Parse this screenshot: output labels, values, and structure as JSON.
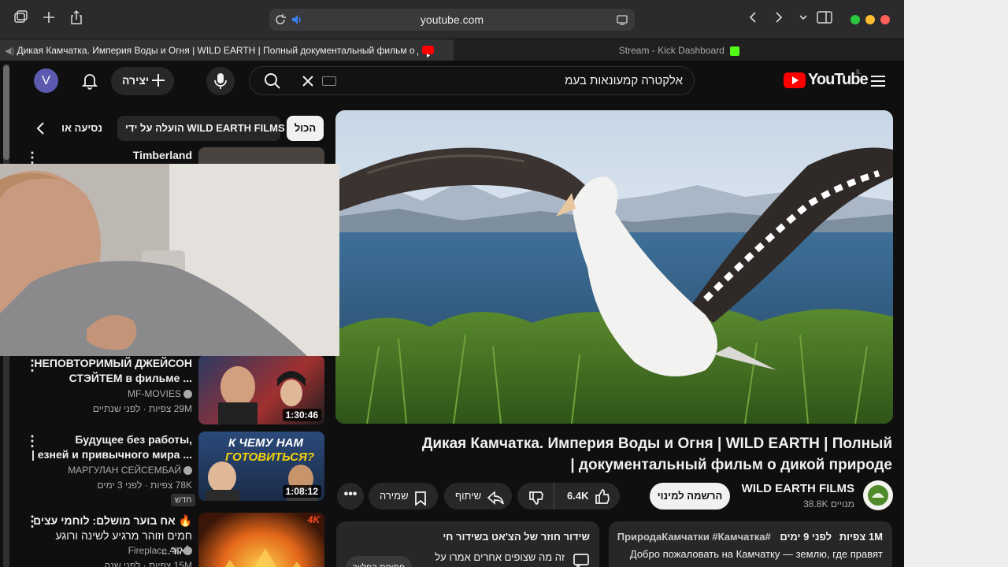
{
  "browser": {
    "url": "youtube.com",
    "tabs": [
      {
        "title": "Дикая Камчатка. Империя Воды и Огня | WILD EARTH | Полный документальный фильм о дикой пр..."
      },
      {
        "title": "Stream - Kick Dashboard"
      }
    ]
  },
  "youtube": {
    "logo_text": "YouTube",
    "logo_region": "IL",
    "avatar_letter": "V",
    "create_label": "יצירה",
    "search_query": "אלקטרה קמעונאות בעמ",
    "chips": {
      "all": "הכול",
      "uploaded_by": "הועלה על ידי WILD EARTH FILMS",
      "travel": "נסיעה או"
    },
    "video": {
      "title": "Дикая Камчатка. Империя Воды и Огня | WILD EARTH | Полный документальный фильм о дикой природе |",
      "title_line1": "Дикая Камчатка. Империя Воды и Огня | WILD EARTH | Полный",
      "title_line2": "документальный фильм о дикой природе |",
      "channel": "WILD EARTH FILMS",
      "subscribers": "38.8K מנויים",
      "subscribe_label": "הרשמה למינוי",
      "likes": "6.4K",
      "share_label": "שיתוף",
      "save_label": "שמירה"
    },
    "description": {
      "stats_views": "1M צפיות",
      "stats_time": "לפני 9 ימים",
      "hashtags": "#ПриродаКамчатки #Камчатка",
      "text": "Добро пожаловать на Камчатку — землю, где правят"
    },
    "chat": {
      "line1": "שידור חוזר של הצ'אט בשידור חי",
      "line2": "זה מה שצופים אחרים אמרו על",
      "open_label": "פתיחת הפלייר"
    },
    "recommended": [
      {
        "title": "Timberland",
        "meta_line1": "",
        "meta_line2": "",
        "duration": ""
      },
      {
        "title_line1": "НЕПОВТОРИМЫЙ ДЖЕЙСОН",
        "title_line2": "СТЭЙТЕМ в фильме ...",
        "channel": "MF-MOVIES",
        "views": "29M צפיות",
        "age": "לפני שנתיים",
        "duration": "1:30:46"
      },
      {
        "title_line1": "Будущее без работы,",
        "title_line2": "| езней и привычного мира ...",
        "channel": "МАРГУЛАН СЕЙСЕМБАЙ",
        "views": "78K צפיות",
        "age": "לפני 3 ימים",
        "badge": "חדש",
        "duration": "1:08:12",
        "thumb_text1": "К ЧЕМУ НАМ",
        "thumb_text2": "ГОТОВИТЬСЯ?"
      },
      {
        "title_line1": "🔥 אח בוער מושלם: לוחמי עצים",
        "title_line2": "חמים וזוהר מרגיע לשינה ורוגע לאור...",
        "channel": "Fireplace 4K",
        "views": "15M צפיות",
        "age": "לפני שנה",
        "thumb_badge": "4K"
      }
    ]
  },
  "colors": {
    "yt_red": "#ff0000",
    "kick_green": "#53fc18",
    "bg": "#0f0f0f"
  }
}
